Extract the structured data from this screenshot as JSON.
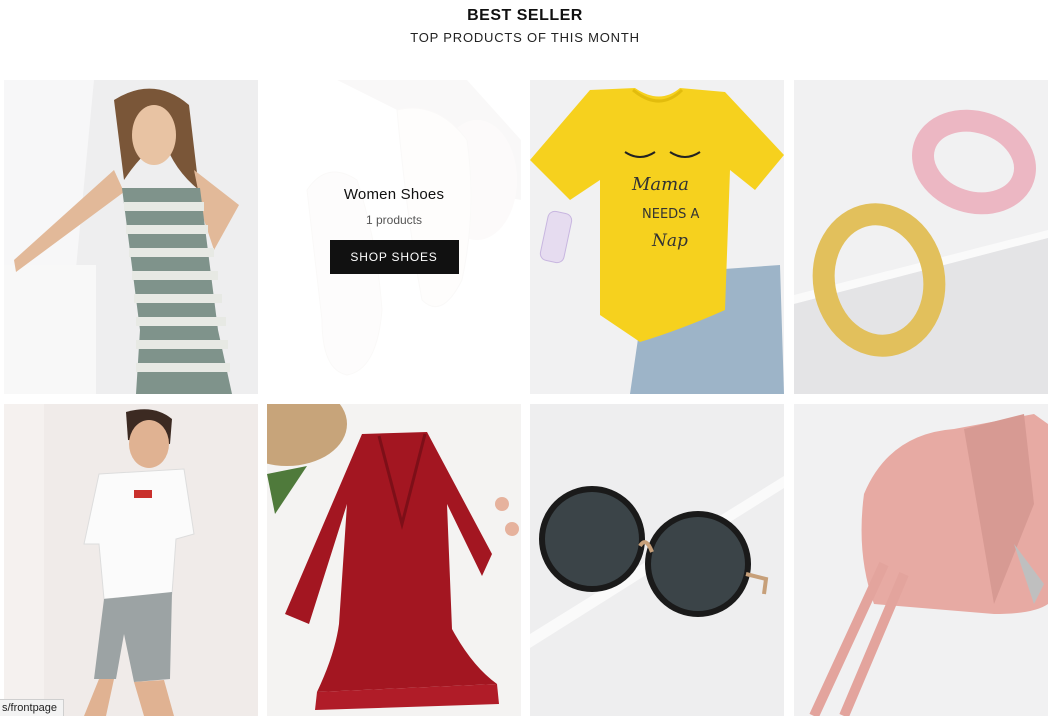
{
  "section": {
    "title": "BEST SELLER",
    "subtitle": "TOP PRODUCTS OF THIS MONTH"
  },
  "products": [
    {
      "icon": "striped-dress-model-image"
    },
    {
      "icon": "white-sandals-image",
      "collection": {
        "name": "Women Shoes",
        "count": "1 products",
        "button": "SHOP SHOES"
      }
    },
    {
      "icon": "yellow-tshirt-image"
    },
    {
      "icon": "headbands-image"
    },
    {
      "icon": "man-tshirt-shorts-image"
    },
    {
      "icon": "red-wrap-dress-image"
    },
    {
      "icon": "round-sunglasses-image"
    },
    {
      "icon": "pink-backpack-image"
    }
  ],
  "status_bar": {
    "url": "s/frontpage"
  }
}
